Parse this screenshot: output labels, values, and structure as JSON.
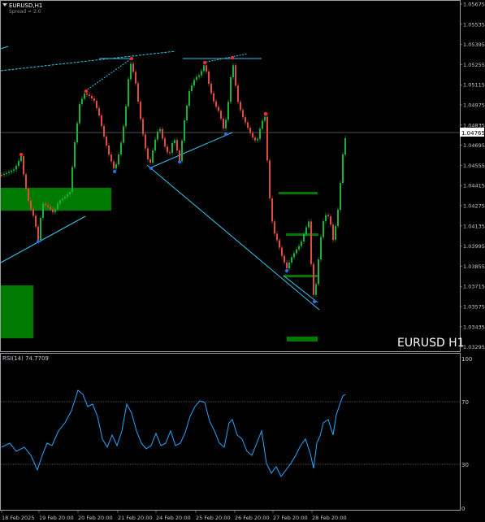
{
  "header": {
    "symbol": "EURUSD,H1",
    "spread": "Spread = 2.0"
  },
  "watermark": "EURUSD H1",
  "colors": {
    "background": "#000000",
    "grid": "#9aa0a6",
    "bull": "#18b33a",
    "bear": "#e04a3f",
    "trendline": "#36c5e8",
    "zone": "#007a00",
    "rsi": "#2aa7ff",
    "swing_high": "#ff2b2b",
    "swing_low": "#2b6dff"
  },
  "price_axis": {
    "ticks": [
      "1.05675",
      "1.05535",
      "1.05395",
      "1.05255",
      "1.05115",
      "1.04975",
      "1.04835",
      "1.04695",
      "1.04555",
      "1.04415",
      "1.04275",
      "1.04135",
      "1.03995",
      "1.03855",
      "1.03715",
      "1.03575",
      "1.03435",
      "1.03295"
    ],
    "current_price": "1.04765"
  },
  "rsi_panel": {
    "label": "RSI(14) 74.7709",
    "levels": [
      "100",
      "70",
      "30",
      "0"
    ]
  },
  "time_axis": [
    "18 Feb 2025",
    "19 Feb 20:00",
    "20 Feb 20:00",
    "21 Feb 20:00",
    "24 Feb 20:00",
    "25 Feb 20:00",
    "26 Feb 20:00",
    "27 Feb 20:00",
    "28 Feb 20:00"
  ]
}
